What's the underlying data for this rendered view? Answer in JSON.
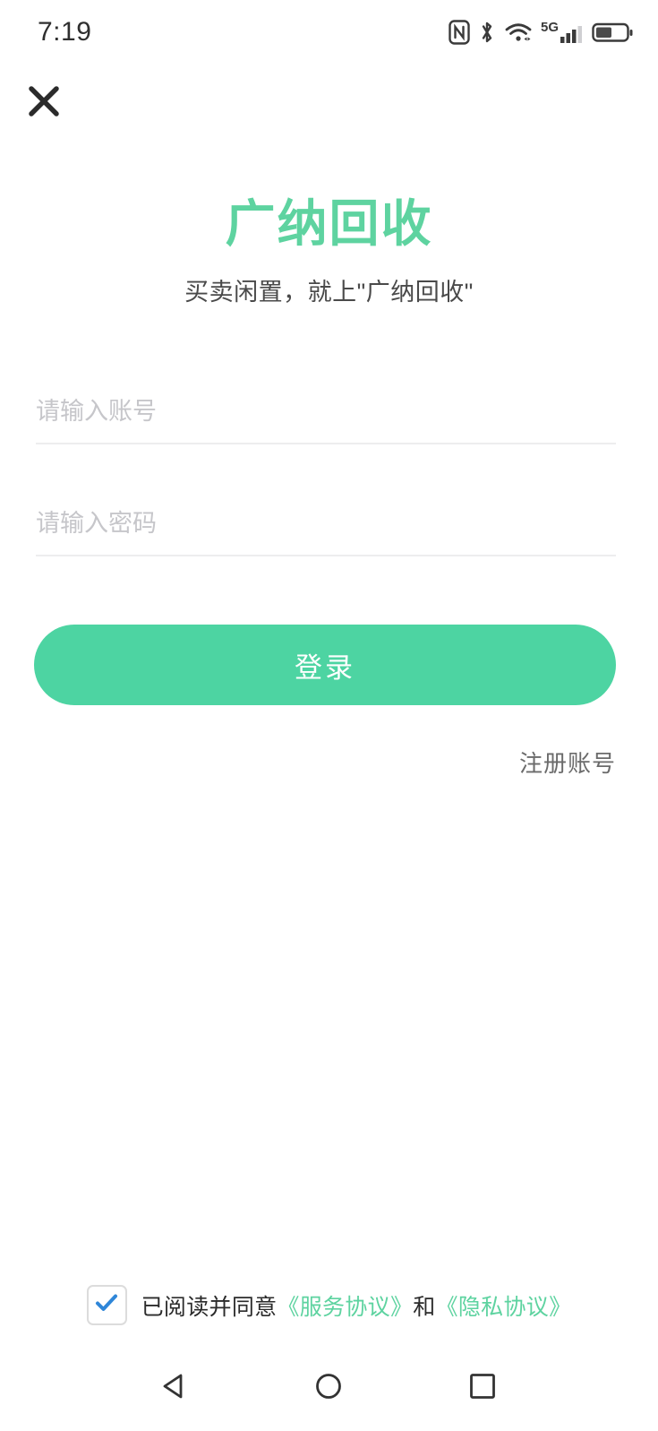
{
  "status_bar": {
    "time": "7:19",
    "icons": [
      {
        "name": "nfc-icon"
      },
      {
        "name": "bluetooth-icon"
      },
      {
        "name": "wifi-icon"
      },
      {
        "name": "signal-5g-icon",
        "label": "5G"
      },
      {
        "name": "battery-icon",
        "level_percent": 50
      }
    ]
  },
  "header": {
    "close_icon": "close-icon"
  },
  "brand": {
    "title": "广纳回收",
    "subtitle": "买卖闲置，就上\"广纳回收\"",
    "title_color": "#5ed3a0"
  },
  "form": {
    "account": {
      "value": "",
      "placeholder": "请输入账号"
    },
    "password": {
      "value": "",
      "placeholder": "请输入密码"
    }
  },
  "actions": {
    "login_label": "登录",
    "login_color": "#4dd4a2",
    "register_label": "注册账号"
  },
  "agreement": {
    "checked": true,
    "check_color": "#2f86d8",
    "prefix": "已阅读并同意",
    "service_link": "《服务协议》",
    "conjunction": "和",
    "privacy_link": "《隐私协议》",
    "link_color": "#5ed3a0"
  },
  "nav_bar": {
    "back": "back-icon",
    "home": "home-icon",
    "recents": "recents-icon"
  }
}
